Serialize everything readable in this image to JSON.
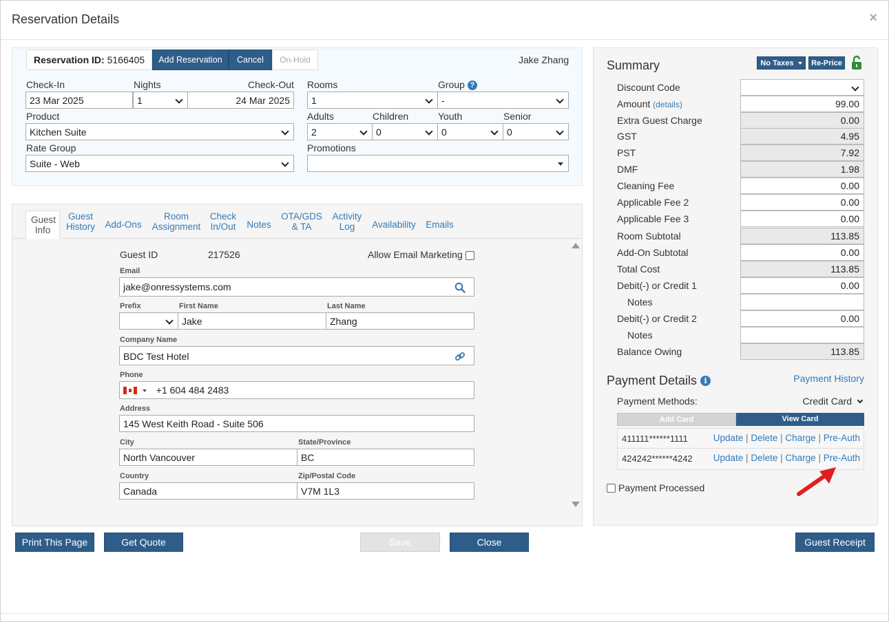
{
  "modal": {
    "title": "Reservation Details",
    "close": "×"
  },
  "reservation": {
    "id_label": "Reservation ID:",
    "id_value": "5166405",
    "add_btn": "Add Reservation",
    "cancel_btn": "Cancel",
    "onhold_btn": "On-Hold",
    "guest_name": "Jake Zhang",
    "checkin_label": "Check-In",
    "checkin": "23 Mar 2025",
    "nights_label": "Nights",
    "nights": "1",
    "checkout_label": "Check-Out",
    "checkout": "24 Mar 2025",
    "rooms_label": "Rooms",
    "rooms": "1",
    "group_label": "Group",
    "group": "-",
    "product_label": "Product",
    "product": "Kitchen Suite",
    "adults_label": "Adults",
    "adults": "2",
    "children_label": "Children",
    "children": "0",
    "youth_label": "Youth",
    "youth": "0",
    "senior_label": "Senior",
    "senior": "0",
    "rategroup_label": "Rate Group",
    "rategroup": "Suite - Web",
    "promotions_label": "Promotions",
    "promotions": ""
  },
  "tabs": [
    {
      "label": "Guest Info"
    },
    {
      "label": "Guest History"
    },
    {
      "label": "Add-Ons"
    },
    {
      "label": "Room Assignment"
    },
    {
      "label": "Check In/Out"
    },
    {
      "label": "Notes"
    },
    {
      "label": "OTA/GDS & TA"
    },
    {
      "label": "Activity Log"
    },
    {
      "label": "Availability"
    },
    {
      "label": "Emails"
    }
  ],
  "guest": {
    "id_label": "Guest ID",
    "id_value": "217526",
    "marketing_label": "Allow Email Marketing",
    "email_label": "Email",
    "email": "jake@onressystems.com",
    "prefix_label": "Prefix",
    "prefix": "",
    "firstname_label": "First Name",
    "firstname": "Jake",
    "lastname_label": "Last Name",
    "lastname": "Zhang",
    "company_label": "Company Name",
    "company": "BDC Test Hotel",
    "phone_label": "Phone",
    "phone": "+1 604 484 2483",
    "address_label": "Address",
    "address": "145 West Keith Road - Suite 506",
    "city_label": "City",
    "city": "North Vancouver",
    "state_label": "State/Province",
    "state": "BC",
    "country_label": "Country",
    "country": "Canada",
    "zip_label": "Zip/Postal Code",
    "zip": "V7M 1L3"
  },
  "summary": {
    "title": "Summary",
    "notaxes_btn": "No Taxes",
    "reprice_btn": "Re-Price",
    "discount_label": "Discount Code",
    "amount_label": "Amount",
    "amount_details": "(details)",
    "rows": [
      {
        "label": "Amount",
        "value": "99.00"
      },
      {
        "label": "Extra Guest Charge",
        "value": "0.00"
      },
      {
        "label": "GST",
        "value": "4.95"
      },
      {
        "label": "PST",
        "value": "7.92"
      },
      {
        "label": "DMF",
        "value": "1.98"
      },
      {
        "label": "Cleaning Fee",
        "value": "0.00"
      },
      {
        "label": "Applicable Fee 2",
        "value": "0.00"
      },
      {
        "label": "Applicable Fee 3",
        "value": "0.00"
      },
      {
        "label": "Room Subtotal",
        "value": "113.85"
      },
      {
        "label": "Add-On Subtotal",
        "value": "0.00"
      },
      {
        "label": "Total Cost",
        "value": "113.85"
      },
      {
        "label": "Debit(-) or Credit 1",
        "value": "0.00"
      },
      {
        "label": "Notes",
        "value": ""
      },
      {
        "label": "Debit(-) or Credit 2",
        "value": "0.00"
      },
      {
        "label": "Notes",
        "value": ""
      },
      {
        "label": "Balance Owing",
        "value": "113.85"
      }
    ]
  },
  "payment": {
    "title": "Payment Details",
    "history_link": "Payment History",
    "methods_label": "Payment Methods:",
    "method": "Credit Card",
    "add_card": "Add Card",
    "view_card": "View Card",
    "cards": [
      {
        "number": "411111******1111"
      },
      {
        "number": "424242******4242"
      }
    ],
    "actions": {
      "update": "Update",
      "delete": "Delete",
      "charge": "Charge",
      "preauth": "Pre-Auth",
      "sep": "|"
    },
    "processed_label": "Payment Processed"
  },
  "footer": {
    "print": "Print This Page",
    "quote": "Get Quote",
    "save": "Save",
    "close": "Close",
    "receipt": "Guest Receipt"
  },
  "colors": {
    "primary": "#2f5d8a",
    "link": "#337ab7",
    "lock_green": "#2e8b3a",
    "arrow_red": "#e02020"
  }
}
